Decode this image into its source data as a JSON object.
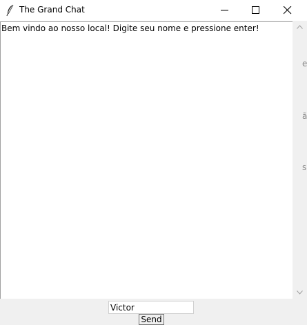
{
  "window": {
    "title": "The Grand Chat",
    "icon": "feather-icon",
    "controls": [
      "minimize-icon",
      "maximize-icon",
      "close-icon"
    ]
  },
  "chat": {
    "messages": [
      "Bem vindo ao nosso local! Digite seu nome e pressione enter!"
    ]
  },
  "input": {
    "value": "Victor"
  },
  "send": {
    "label": "Send"
  },
  "background_glyphs": [
    "e",
    "ã",
    "s"
  ]
}
